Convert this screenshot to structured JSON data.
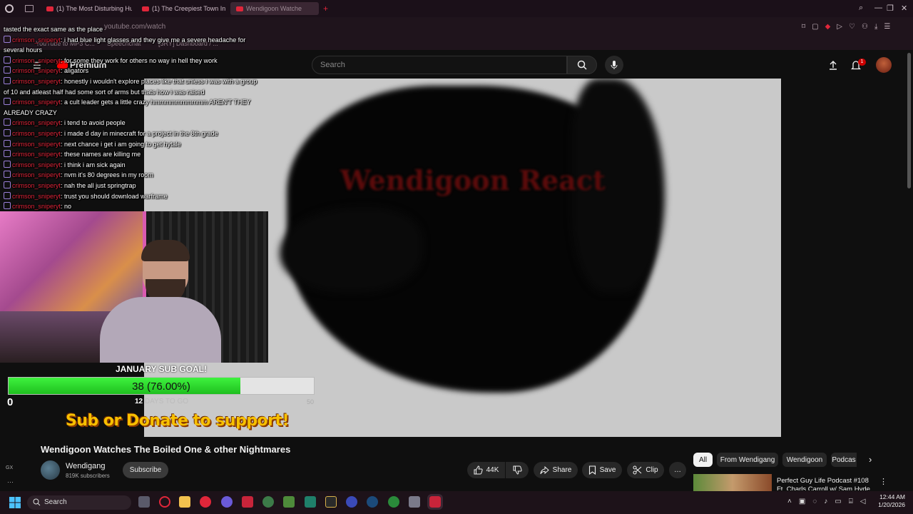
{
  "browser": {
    "tabs": [
      {
        "label": "(1) The Most Disturbing Hu"
      },
      {
        "label": "(1) The Creepiest Town In"
      },
      {
        "label": "Wendigoon Watche"
      }
    ],
    "new_tab": "+",
    "url": "youtube.com/watch",
    "bookmarks": [
      "YouTube to MP3 C...",
      "Speechchat",
      "[3RY] Dashboard / ..."
    ]
  },
  "youtube": {
    "logo_text": "Premium",
    "search_placeholder": "Search",
    "notification_count": "1"
  },
  "video": {
    "overlay_text": "Wendigoon React",
    "title": "Wendigoon Watches The Boiled One & other Nightmares",
    "channel": "Wendigang",
    "subscribers": "819K subscribers",
    "subscribe_label": "Subscribe",
    "likes": "44K",
    "share_label": "Share",
    "save_label": "Save",
    "clip_label": "Clip",
    "more_label": "…"
  },
  "chips": [
    "All",
    "From Wendigang",
    "Wendigoon",
    "Podcas"
  ],
  "recommended": {
    "title": "Perfect Guy Life Podcast #108 Ft. Charls Carroll w/ Sam Hyde"
  },
  "chat": {
    "first_line": "tasted the exact same as the place",
    "username": "crimson_sniperyt",
    "messages": [
      {
        "text": "i had blue light glasses and they give me a severe headache for several hours",
        "wrap": true
      },
      {
        "text": "for some they work for others no way in hell they work",
        "wrap": false
      },
      {
        "text": "aligators",
        "wrap": false
      },
      {
        "text": "honestly i wouldn't explore places like that unless i was with a group of 10 and atleast half had some sort of arms but thats how i was raised",
        "wrap": true
      },
      {
        "text": "a cult leader gets a little crazy hmmmmmmmmmm AREN'T THEY ALREADY CRAZY",
        "wrap": true
      },
      {
        "text": "i tend to avoid people",
        "wrap": false
      },
      {
        "text": "i made d day in minecraft for a project in the 8th grade",
        "wrap": false
      },
      {
        "text": "next chance i get i am going to get hytale",
        "wrap": false
      },
      {
        "text": "these names are killing me",
        "wrap": false
      },
      {
        "text": "i think i am sick again",
        "wrap": false
      },
      {
        "text": "nvm it's 80 degrees in my room",
        "wrap": false
      },
      {
        "text": "nah the all just springtrap",
        "wrap": false
      },
      {
        "text": "trust you should download warframe",
        "wrap": false
      },
      {
        "text": "no",
        "wrap": false
      }
    ]
  },
  "sub_goal": {
    "title": "JANUARY SUB GOAL!",
    "label": "38 (76.00%)",
    "progress": 0.76,
    "min": "0",
    "max": "50",
    "days_number": "12",
    "days_text": "DAYS TO GO",
    "support_text": "Sub or Donate to support!"
  },
  "taskbar": {
    "search": "Search",
    "time": "12:44 AM",
    "date": "1/20/2026"
  },
  "side_label": "GX",
  "colors": {
    "accent_red": "#e0263a",
    "goal_green": "#2fd42f",
    "support_yellow": "#f7c000"
  }
}
